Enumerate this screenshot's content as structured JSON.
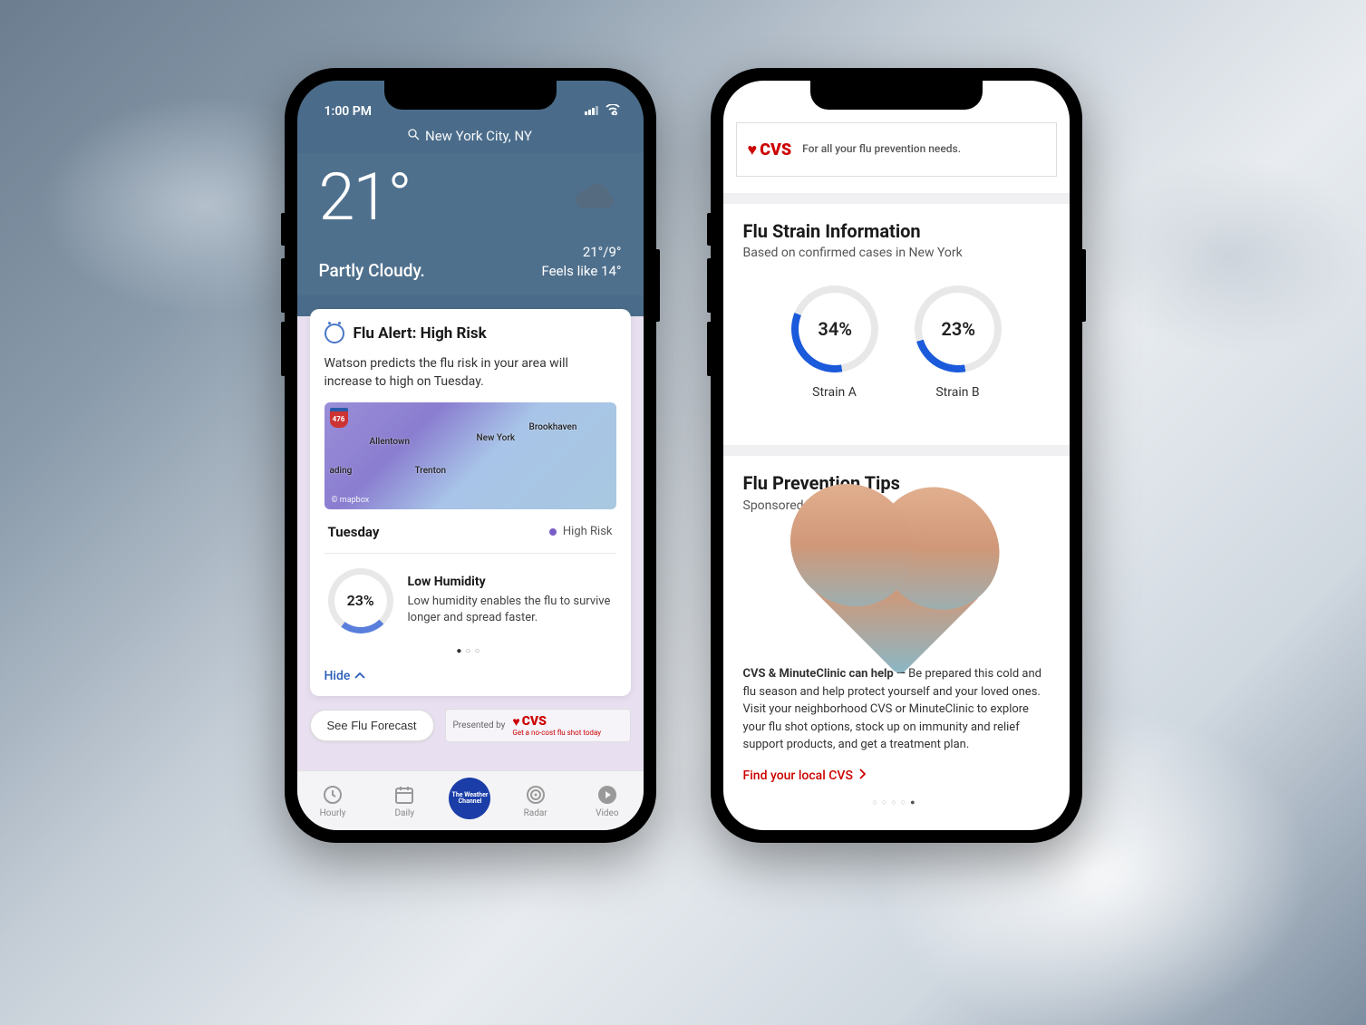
{
  "left": {
    "status": {
      "time": "1:00 PM"
    },
    "search": {
      "location": "New York City, NY"
    },
    "hero": {
      "temp": "21°",
      "condition": "Partly Cloudy.",
      "highlow": "21°/9°",
      "feels": "Feels like 14°"
    },
    "flu": {
      "title": "Flu Alert: High Risk",
      "desc": "Watson predicts the flu risk in your area will increase to high on Tuesday.",
      "map": {
        "shield": "476",
        "labels": {
          "allentown": "Allentown",
          "newyork": "New York",
          "brookhaven": "Brookhaven",
          "trenton": "Trenton",
          "ading": "ading"
        },
        "attribution": "© mapbox"
      },
      "day": "Tuesday",
      "risk": "High Risk",
      "humidity": {
        "pct": "23%",
        "title": "Low Humidity",
        "desc": "Low humidity enables the flu to survive longer and spread faster."
      },
      "hide": "Hide"
    },
    "forecast_btn": "See Flu Forecast",
    "presented": {
      "label": "Presented by",
      "sponsor": "CVS",
      "sponsor_sub": "Get a no-cost flu shot today"
    },
    "tabs": {
      "hourly": "Hourly",
      "daily": "Daily",
      "center": "The Weather Channel",
      "radar": "Radar",
      "video": "Video"
    }
  },
  "right": {
    "ad": {
      "sponsor": "CVS",
      "text": "For all your flu prevention needs."
    },
    "strain_section": {
      "title": "Flu Strain Information",
      "sub": "Based on confirmed cases in New York",
      "a": {
        "pct": "34%",
        "label": "Strain A"
      },
      "b": {
        "pct": "23%",
        "label": "Strain B"
      }
    },
    "tips_section": {
      "title": "Flu Prevention Tips",
      "sponsor_line": "Sponsored ad provided by",
      "sponsor": "CVS",
      "body_bold": "CVS & MinuteClinic can help —",
      "body": "Be prepared this cold and flu season and help protect yourself and your loved ones. Visit your neighborhood CVS or MinuteClinic to explore your flu shot options, stock up on immunity and relief support products, and get a treatment plan.",
      "link": "Find your local CVS"
    }
  },
  "chart_data": [
    {
      "type": "pie",
      "title": "Low Humidity",
      "values": [
        23,
        77
      ],
      "categories": [
        "Humidity",
        "Remaining"
      ],
      "unit": "percent"
    },
    {
      "type": "pie",
      "title": "Strain A",
      "values": [
        34,
        66
      ],
      "categories": [
        "Strain A",
        "Other"
      ],
      "unit": "percent"
    },
    {
      "type": "pie",
      "title": "Strain B",
      "values": [
        23,
        77
      ],
      "categories": [
        "Strain B",
        "Other"
      ],
      "unit": "percent"
    }
  ]
}
